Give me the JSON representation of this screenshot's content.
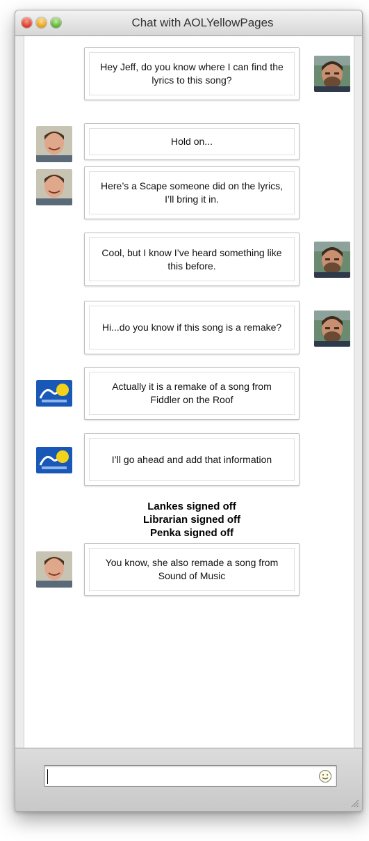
{
  "window": {
    "title": "Chat with AOLYellowPages"
  },
  "messages": [
    {
      "side": "right",
      "avatar": "jeff-photo",
      "text": "Hey Jeff, do you know where I can find the lyrics to this song?"
    },
    {
      "side": "left",
      "avatar": "man-photo",
      "text": "Hold on..."
    },
    {
      "side": "left",
      "avatar": "man-photo",
      "text": "Here’s a Scape someone did on the lyrics, I’ll bring it in."
    },
    {
      "side": "right",
      "avatar": "jeff-photo",
      "text": "Cool, but I know I’ve heard something like this before."
    },
    {
      "side": "right",
      "avatar": "jeff-photo",
      "text": "Hi...do you know if this song is a remake?"
    },
    {
      "side": "left",
      "avatar": "aol-yellowpages-logo",
      "text": "Actually it is a remake of a song from Fiddler on the Roof"
    },
    {
      "side": "left",
      "avatar": "aol-yellowpages-logo",
      "text": "I’ll go ahead and add that information"
    },
    {
      "side": "left",
      "avatar": "man-photo",
      "text": "You know, she also remade a song from Sound of Music"
    }
  ],
  "status_lines": [
    "Lankes signed off",
    "Librarian signed off",
    "Penka signed off"
  ],
  "composer": {
    "value": "",
    "emoji_button": "smiley-icon"
  }
}
